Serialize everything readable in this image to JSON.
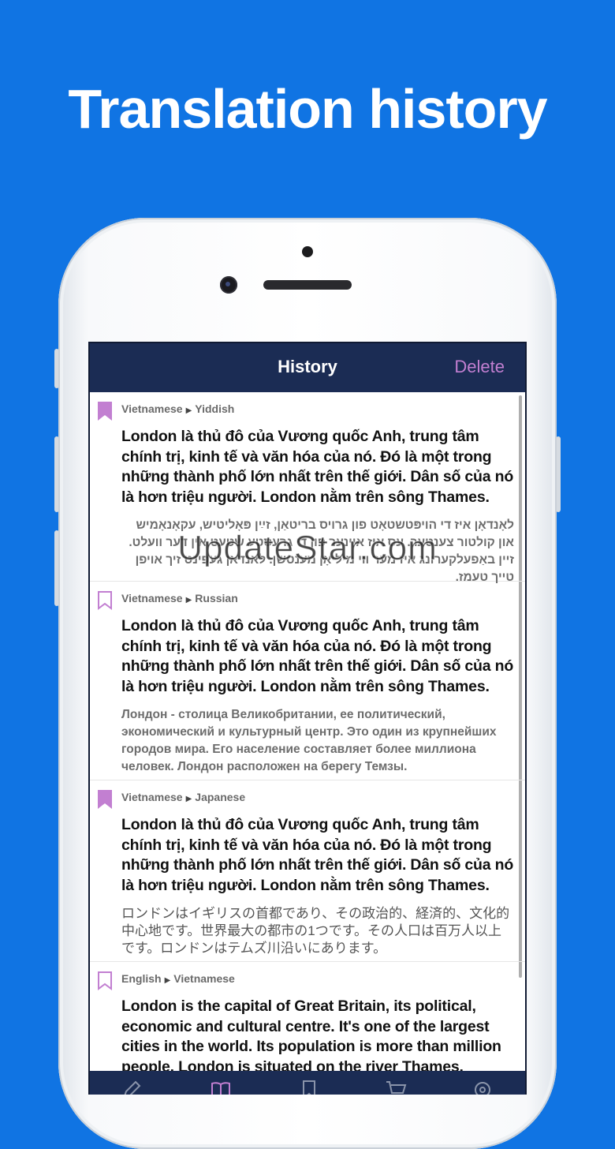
{
  "promo": {
    "title": "Translation history"
  },
  "navbar": {
    "title": "History",
    "delete_label": "Delete"
  },
  "colors": {
    "background": "#1074e3",
    "navbar": "#1b2c54",
    "accent": "#c27fd1"
  },
  "entries": [
    {
      "bookmarked": true,
      "source_lang": "Vietnamese",
      "target_lang": "Yiddish",
      "source_text": "London là thủ đô của Vương quốc Anh, trung tâm chính trị, kinh tế và văn hóa của nó. Đó là một trong những thành phố lớn nhất trên thế giới. Dân số của nó là hơn triệu người. London nằm trên sông Thames.",
      "translation": "לאָנדאָן איז די הויפּטשטאָט פון גרויס בריטאַן, זײַן פּאָליטיש, עקאָנאָמיש און קולטור צענטער. עס איז איינער פון די גרעסטע שטעט אין דער וועלט. זיין באַפעלקערונג איז מער ווי מיליאָן מענטשן. לאנדאן געפינט זיך אויפן טייך טעמז."
    },
    {
      "bookmarked": false,
      "source_lang": "Vietnamese",
      "target_lang": "Russian",
      "source_text": "London là thủ đô của Vương quốc Anh, trung tâm chính trị, kinh tế và văn hóa của nó. Đó là một trong những thành phố lớn nhất trên thế giới. Dân số của nó là hơn triệu người. London nằm trên sông Thames.",
      "translation": "Лондон - столица Великобритании, ее политический, экономический и культурный центр. Это один из крупнейших городов мира. Его население составляет более миллиона человек. Лондон расположен на берегу Темзы."
    },
    {
      "bookmarked": true,
      "source_lang": "Vietnamese",
      "target_lang": "Japanese",
      "source_text": "London là thủ đô của Vương quốc Anh, trung tâm chính trị, kinh tế và văn hóa của nó. Đó là một trong những thành phố lớn nhất trên thế giới. Dân số của nó là hơn triệu người. London nằm trên sông Thames.",
      "translation": "ロンドンはイギリスの首都であり、その政治的、経済的、文化的中心地です。世界最大の都市の1つです。その人口は百万人以上です。ロンドンはテムズ川沿いにあります。"
    },
    {
      "bookmarked": false,
      "source_lang": "English",
      "target_lang": "Vietnamese",
      "source_text": "London is the capital of Great Britain, its political, economic and cultural centre. It's one of the largest cities in the world. Its population is more than million people. London is situated on the river Thames.",
      "translation": ""
    }
  ],
  "tabs": [
    "pencil-icon",
    "book-icon",
    "bookmark-icon",
    "cart-icon",
    "gear-icon"
  ],
  "watermark": "UpdateStar.com"
}
